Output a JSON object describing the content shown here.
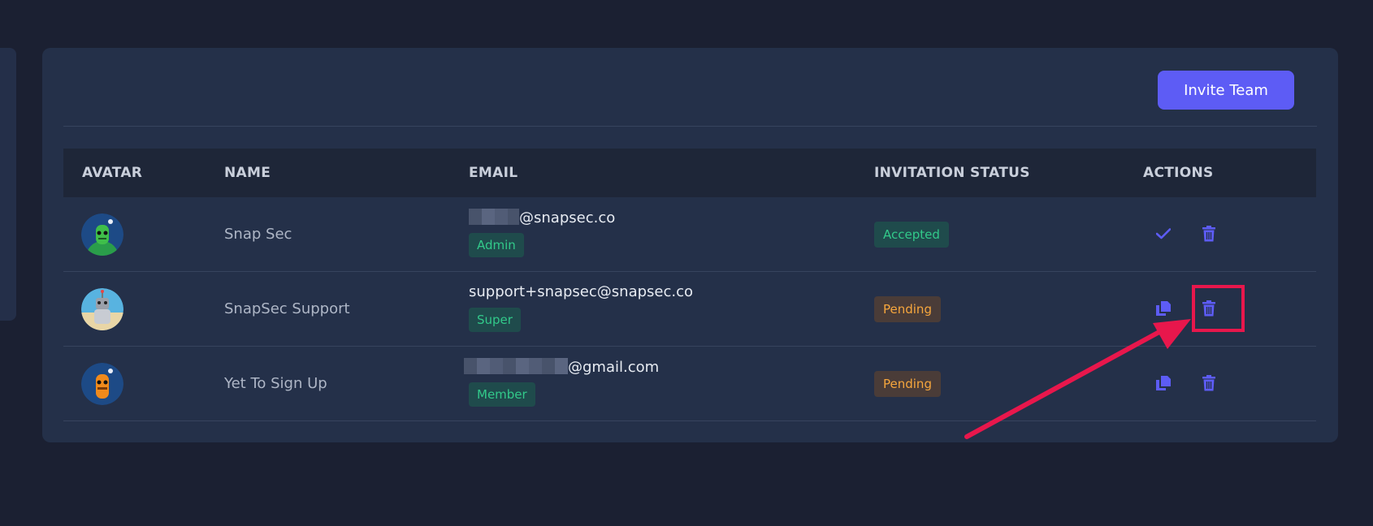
{
  "toolbar": {
    "invite_label": "Invite Team"
  },
  "table": {
    "headers": {
      "avatar": "AVATAR",
      "name": "NAME",
      "email": "EMAIL",
      "status": "INVITATION STATUS",
      "actions": "ACTIONS"
    },
    "rows": [
      {
        "name": "Snap Sec",
        "email_suffix": "@snapsec.co",
        "email_redacted": true,
        "role": "Admin",
        "status": "Accepted",
        "primary_action_icon": "check-icon",
        "secondary_action_icon": "trash-icon"
      },
      {
        "name": "SnapSec Support",
        "email_suffix": "support+snapsec@snapsec.co",
        "email_redacted": false,
        "role": "Super",
        "status": "Pending",
        "primary_action_icon": "copy-icon",
        "secondary_action_icon": "trash-icon"
      },
      {
        "name": "Yet To Sign Up",
        "email_suffix": "@gmail.com",
        "email_redacted": true,
        "role": "Member",
        "status": "Pending",
        "primary_action_icon": "copy-icon",
        "secondary_action_icon": "trash-icon"
      }
    ]
  },
  "colors": {
    "page_bg": "#1b2032",
    "card_bg": "#243049",
    "accent": "#5d5cf5",
    "accepted_text": "#32c98a",
    "pending_text": "#f6a63d",
    "annotation": "#e8174c"
  }
}
